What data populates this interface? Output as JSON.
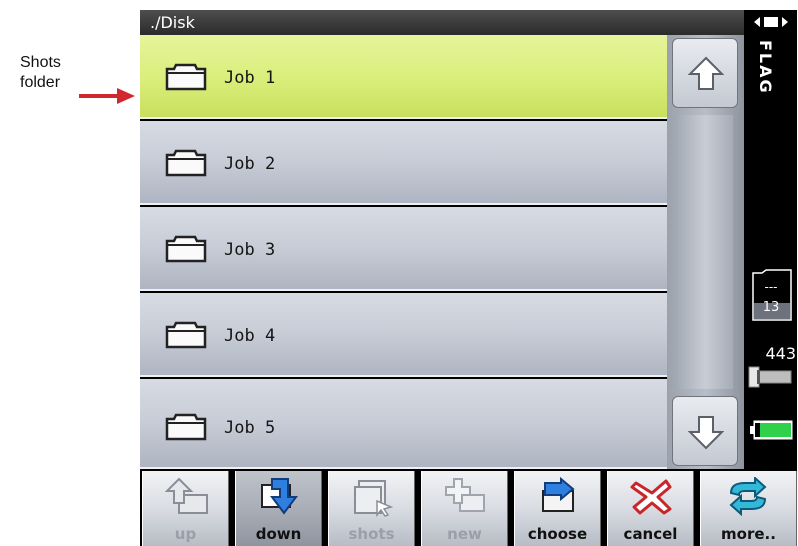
{
  "callout": {
    "label_line1": "Shots",
    "label_line2": "folder",
    "arrow_color": "#d0282e"
  },
  "path": "./Disk",
  "list": {
    "items": [
      {
        "label": "Job 1",
        "selected": true
      },
      {
        "label": "Job 2",
        "selected": false
      },
      {
        "label": "Job 3",
        "selected": false
      },
      {
        "label": "Job 4",
        "selected": false
      },
      {
        "label": "Job 5",
        "selected": false
      }
    ],
    "item_icon": "folder-icon",
    "selected_color": "#d9ee7a"
  },
  "scroll": {
    "up_icon": "arrow-up-icon",
    "down_icon": "arrow-down-icon"
  },
  "status": {
    "mode_label": "FLAG",
    "card_dash": "---",
    "card_count": "13",
    "shots_remaining": "443",
    "battery_color": "#2fd14a",
    "lens_icon": "lens-icon",
    "card_icon": "memory-card-icon",
    "battery_icon": "battery-icon",
    "mode_icon": "mode-indicator-icon"
  },
  "toolbar": {
    "buttons": [
      {
        "label": "up",
        "icon": "folder-up-icon",
        "enabled": false
      },
      {
        "label": "down",
        "icon": "folder-down-icon",
        "enabled": true,
        "active": true
      },
      {
        "label": "shots",
        "icon": "shots-icon",
        "enabled": false
      },
      {
        "label": "new",
        "icon": "new-folder-icon",
        "enabled": false
      },
      {
        "label": "choose",
        "icon": "choose-icon",
        "enabled": true
      },
      {
        "label": "cancel",
        "icon": "cancel-icon",
        "enabled": true
      },
      {
        "label": "more..",
        "icon": "more-icon",
        "enabled": true
      }
    ]
  }
}
